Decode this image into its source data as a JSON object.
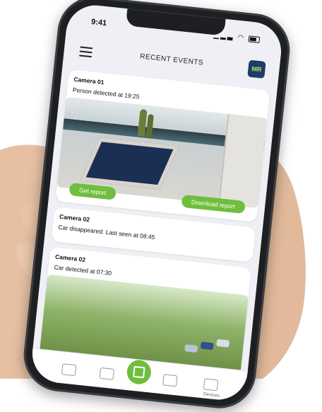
{
  "status_bar": {
    "time": "9:41",
    "signal": "▁▂▃",
    "wifi": "◠"
  },
  "header": {
    "title": "RECENT EVENTS",
    "avatar_initials": "MR"
  },
  "events": [
    {
      "camera": "Camera 01",
      "message": "Person detected at 19:25"
    },
    {
      "camera": "Camera 02",
      "message": "Car disappeared. Last seen at 08:45"
    },
    {
      "camera": "Camera 02",
      "message": "Car detected at 07:30"
    }
  ],
  "actions": {
    "get_report": "Get report",
    "download_report": "Download report"
  },
  "navbar": {
    "devices_label": "Devices"
  },
  "colors": {
    "accent": "#6fbe3d",
    "avatar_bg": "#1f3b66",
    "avatar_text": "#b5e36b"
  }
}
